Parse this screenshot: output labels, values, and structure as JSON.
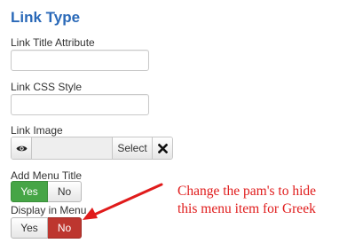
{
  "section": {
    "title": "Link Type"
  },
  "fields": {
    "link_title": {
      "label": "Link Title Attribute",
      "value": ""
    },
    "link_css": {
      "label": "Link CSS Style",
      "value": ""
    },
    "link_image": {
      "label": "Link Image",
      "select_label": "Select",
      "preview_icon": "eye-icon",
      "clear_icon": "x-icon"
    },
    "add_menu_title": {
      "label": "Add Menu Title",
      "options": [
        "Yes",
        "No"
      ],
      "selected": "Yes"
    },
    "display_in_menu": {
      "label": "Display in Menu",
      "options": [
        "Yes",
        "No"
      ],
      "selected": "No"
    }
  },
  "annotation": {
    "line1": "Change the pam's to hide",
    "line2": "this menu item for Greek",
    "color": "#e01b1b"
  },
  "colors": {
    "heading": "#2a69b8",
    "yes_active": "#46a546",
    "no_active": "#bd362f"
  }
}
